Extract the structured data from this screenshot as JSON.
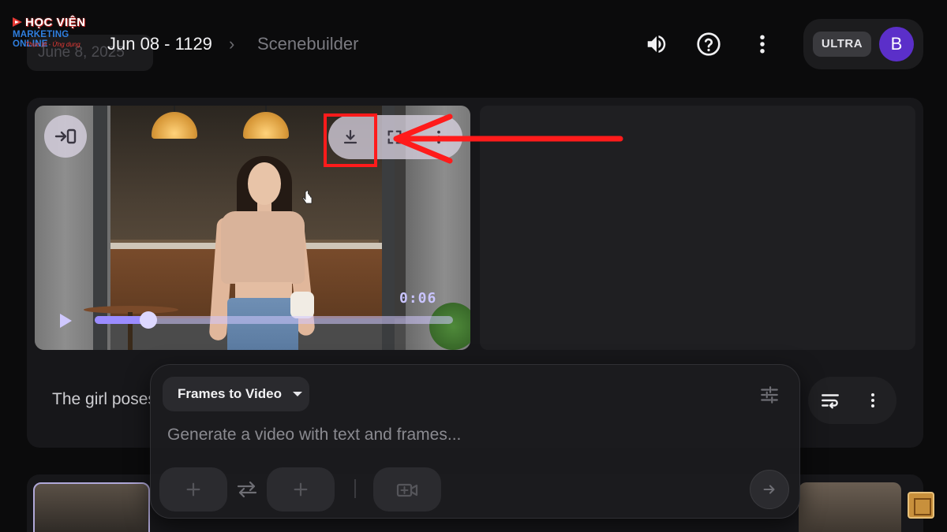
{
  "logo": {
    "line1": "HỌC VIỆN",
    "line2": "MARKETING ONLINE",
    "line3": "Thực tế - Ứng dụng"
  },
  "header": {
    "ghost_date": "June 8, 2025",
    "project": "Jun 08 - 1129",
    "separator": "›",
    "page": "Scenebuilder",
    "icons": [
      "volume-icon",
      "help-icon",
      "more-vertical-icon"
    ],
    "plan_badge": "ULTRA",
    "avatar_initial": "B"
  },
  "video": {
    "timestamp": "0:06",
    "progress": 0.15,
    "controls": [
      "insert-clip-icon",
      "download-icon",
      "fullscreen-icon",
      "more-vertical-icon"
    ]
  },
  "clip": {
    "description": "The girl poses"
  },
  "composer": {
    "mode_label": "Frames to Video",
    "prompt_placeholder": "Generate a video with text and frames..."
  },
  "colors": {
    "accent": "#9b8cff",
    "avatar": "#5b2fc9",
    "annotation": "#ff1b1b"
  }
}
